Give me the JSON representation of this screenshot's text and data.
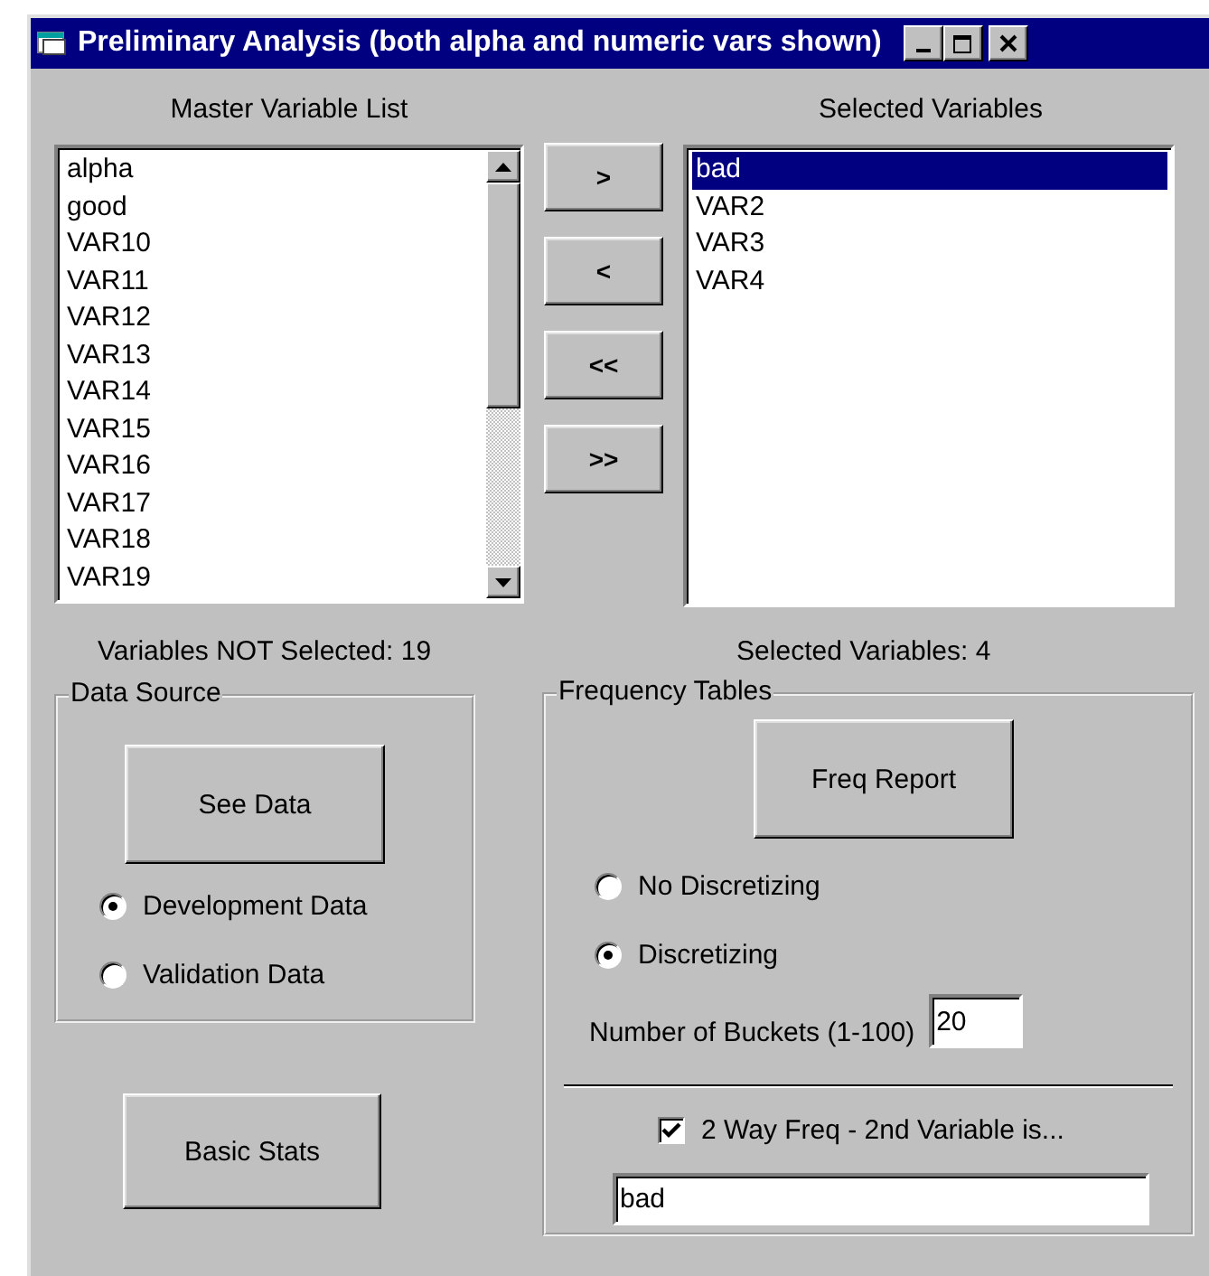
{
  "window": {
    "title": "Preliminary Analysis (both alpha and numeric vars shown)"
  },
  "master_list": {
    "label": "Master Variable List",
    "items": [
      {
        "text": "alpha",
        "selected": false
      },
      {
        "text": "good",
        "selected": false
      },
      {
        "text": "VAR10",
        "selected": false
      },
      {
        "text": "VAR11",
        "selected": false
      },
      {
        "text": "VAR12",
        "selected": false
      },
      {
        "text": "VAR13",
        "selected": false
      },
      {
        "text": "VAR14",
        "selected": false
      },
      {
        "text": "VAR15",
        "selected": false
      },
      {
        "text": "VAR16",
        "selected": false
      },
      {
        "text": "VAR17",
        "selected": false
      },
      {
        "text": "VAR18",
        "selected": false
      },
      {
        "text": "VAR19",
        "selected": false
      }
    ]
  },
  "move_buttons": [
    ">",
    "<",
    "<<",
    ">>"
  ],
  "selected_list": {
    "label": "Selected Variables",
    "items": [
      {
        "text": "bad",
        "selected": true
      },
      {
        "text": "VAR2",
        "selected": false
      },
      {
        "text": "VAR3",
        "selected": false
      },
      {
        "text": "VAR4",
        "selected": false
      }
    ]
  },
  "counts": {
    "not_selected": "Variables NOT Selected: 19",
    "selected": "Selected Variables: 4"
  },
  "data_source": {
    "title": "Data Source",
    "button": "See Data",
    "options": [
      {
        "label": "Development Data",
        "selected": true
      },
      {
        "label": "Validation Data",
        "selected": false
      }
    ]
  },
  "basic_stats_button": "Basic Stats",
  "frequency_tables": {
    "title": "Frequency Tables",
    "button": "Freq Report",
    "options": [
      {
        "label": "No Discretizing",
        "selected": false
      },
      {
        "label": "Discretizing",
        "selected": true
      }
    ],
    "buckets": {
      "label": "Number of Buckets (1-100)",
      "value": "20"
    },
    "two_way": {
      "label": "2 Way Freq - 2nd Variable is...",
      "checked": true
    },
    "second_variable": {
      "value": "bad"
    }
  }
}
